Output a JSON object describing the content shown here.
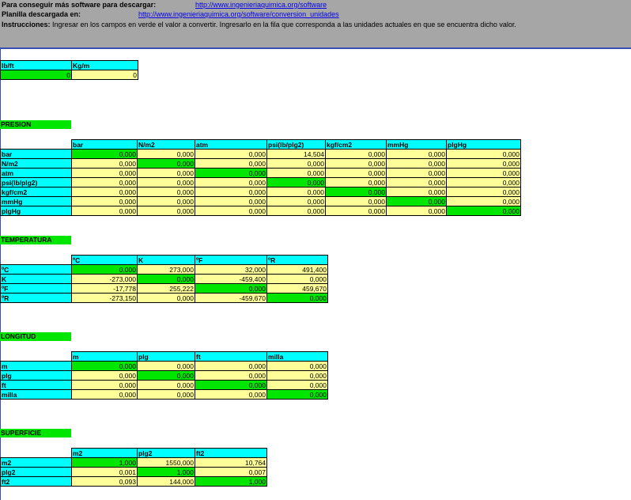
{
  "header": {
    "line1_label": "Para conseguir más software para descargar:",
    "line1_link": "http://www.ingenieriaquimica.org/software",
    "line2_label": "Planilla descargada en:",
    "line2_link": "http://www.ingenieriaquimica.org/software/conversion_unidades",
    "line3_label": "Instrucciones:",
    "line3_text": "Ingresar en los campos en verde el valor a convertir. Ingresarlo en la fila que corresponda a las unidades actuales en que se encuentra dicho valor."
  },
  "lbft": {
    "headers": [
      "lb/ft",
      "Kg/m"
    ],
    "values": [
      "0",
      "0"
    ]
  },
  "presion": {
    "title": "PRESION",
    "headers": [
      "bar",
      "N/m2",
      "atm",
      "psi(lb/plg2)",
      "kgf/cm2",
      "mmHg",
      "plgHg"
    ],
    "rows": [
      {
        "label": "bar",
        "values": [
          "0,000",
          "0,000",
          "0,000",
          "14,504",
          "0,000",
          "0,000",
          "0,000"
        ]
      },
      {
        "label": "N/m2",
        "values": [
          "0,000",
          "0,000",
          "0,000",
          "0,000",
          "0,000",
          "0,000",
          "0,000"
        ]
      },
      {
        "label": "atm",
        "values": [
          "0,000",
          "0,000",
          "0,000",
          "0,000",
          "0,000",
          "0,000",
          "0,000"
        ]
      },
      {
        "label": "psi(lb/plg2)",
        "values": [
          "0,000",
          "0,000",
          "0,000",
          "0,000",
          "0,000",
          "0,000",
          "0,000"
        ]
      },
      {
        "label": "kgf/cm2",
        "values": [
          "0,000",
          "0,000",
          "0,000",
          "0,000",
          "0,000",
          "0,000",
          "0,000"
        ]
      },
      {
        "label": "mmHg",
        "values": [
          "0,000",
          "0,000",
          "0,000",
          "0,000",
          "0,000",
          "0,000",
          "0,000"
        ]
      },
      {
        "label": "plgHg",
        "values": [
          "0,000",
          "0,000",
          "0,000",
          "0,000",
          "0,000",
          "0,000",
          "0,000"
        ]
      }
    ]
  },
  "temperatura": {
    "title": "TEMPERATURA",
    "headers": [
      "ºC",
      "K",
      "ºF",
      "ºR"
    ],
    "rows": [
      {
        "label": "ºC",
        "values": [
          "0,000",
          "273,000",
          "32,000",
          "491,400"
        ]
      },
      {
        "label": "K",
        "values": [
          "-273,000",
          "0,000",
          "-459,400",
          "0,000"
        ]
      },
      {
        "label": "ºF",
        "values": [
          "-17,778",
          "255,222",
          "0,000",
          "459,670"
        ]
      },
      {
        "label": "ºR",
        "values": [
          "-273,150",
          "0,000",
          "-459,670",
          "0,000"
        ]
      }
    ]
  },
  "longitud": {
    "title": "LONGITUD",
    "headers": [
      "m",
      "plg",
      "ft",
      "milla"
    ],
    "rows": [
      {
        "label": "m",
        "values": [
          "0,000",
          "0,000",
          "0,000",
          "0,000"
        ]
      },
      {
        "label": "plg",
        "values": [
          "0,000",
          "0,000",
          "0,000",
          "0,000"
        ]
      },
      {
        "label": "ft",
        "values": [
          "0,000",
          "0,000",
          "0,000",
          "0,000"
        ]
      },
      {
        "label": "milla",
        "values": [
          "0,000",
          "0,000",
          "0,000",
          "0,000"
        ]
      }
    ]
  },
  "superficie": {
    "title": "SUPERFICIE",
    "headers": [
      "m2",
      "plg2",
      "ft2"
    ],
    "rows": [
      {
        "label": "m2",
        "values": [
          "1,000",
          "1550,000",
          "10,764"
        ]
      },
      {
        "label": "plg2",
        "values": [
          "0,001",
          "1,000",
          "0,007"
        ]
      },
      {
        "label": "ft2",
        "values": [
          "0,093",
          "144,000",
          "1,000"
        ]
      }
    ]
  },
  "colors": {
    "header_bg": "#a6a6a6",
    "cyan": "#00ffff",
    "input_green": "#00e600",
    "output_yellow": "#ffff99"
  }
}
